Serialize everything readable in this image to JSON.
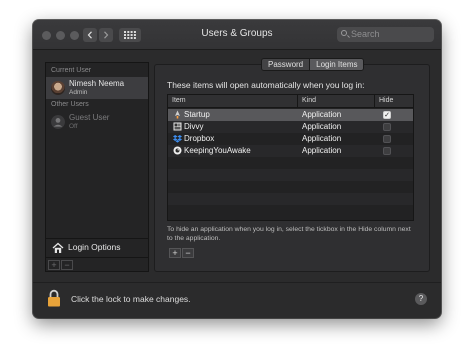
{
  "window": {
    "title": "Users & Groups"
  },
  "toolbar": {
    "back_icon": "chevron-left-icon",
    "forward_icon": "chevron-right-icon",
    "grid_icon": "grid-icon",
    "search_placeholder": "Search"
  },
  "sidebar": {
    "current_user_heading": "Current User",
    "current_user": {
      "name": "Nimesh Neema",
      "role": "Admin"
    },
    "other_users_heading": "Other Users",
    "guest_user": {
      "name": "Guest User",
      "status": "Off"
    },
    "login_options_label": "Login Options",
    "add_label": "+",
    "remove_label": "−"
  },
  "tabs": [
    {
      "label": "Password",
      "active": false
    },
    {
      "label": "Login Items",
      "active": true
    }
  ],
  "login_items": {
    "intro": "These items will open automatically when you log in:",
    "columns": {
      "item": "Item",
      "kind": "Kind",
      "hide": "Hide"
    },
    "rows": [
      {
        "name": "Startup",
        "kind": "Application",
        "hide": true,
        "selected": true
      },
      {
        "name": "Divvy",
        "kind": "Application",
        "hide": false,
        "selected": false
      },
      {
        "name": "Dropbox",
        "kind": "Application",
        "hide": false,
        "selected": false
      },
      {
        "name": "KeepingYouAwake",
        "kind": "Application",
        "hide": false,
        "selected": false
      }
    ],
    "hint": "To hide an application when you log in, select the tickbox in the Hide column next to the application.",
    "add_label": "+",
    "remove_label": "−"
  },
  "footer": {
    "lock_text": "Click the lock to make changes.",
    "help_label": "?"
  },
  "colors": {
    "window_bg": "#2b2b2c",
    "selection": "#58585b",
    "lock": "#e8a33a"
  }
}
